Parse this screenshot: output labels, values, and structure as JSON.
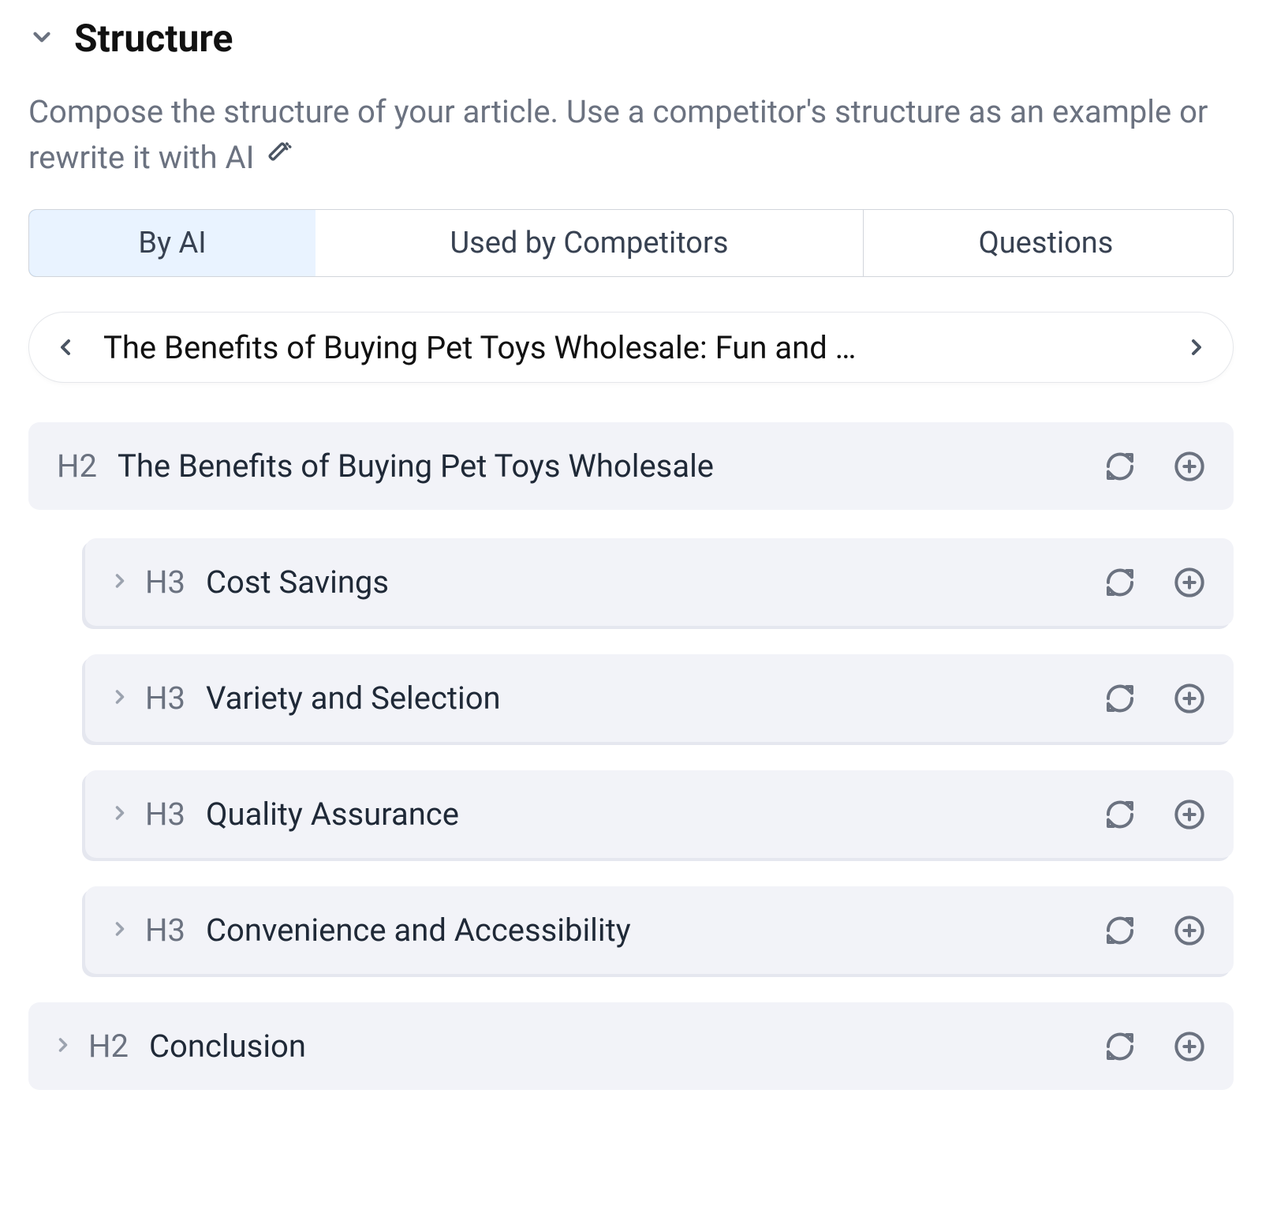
{
  "header": {
    "title": "Structure",
    "description": "Compose the structure of your article. Use a competitor's structure as an example or rewrite it with AI"
  },
  "tabs": {
    "byai": "By AI",
    "competitors": "Used by Competitors",
    "questions": "Questions"
  },
  "titleNav": {
    "text": "The Benefits of Buying Pet Toys Wholesale: Fun and …"
  },
  "outline": {
    "h2_main": {
      "level": "H2",
      "title": "The Benefits of Buying Pet Toys Wholesale"
    },
    "h3_1": {
      "level": "H3",
      "title": "Cost Savings"
    },
    "h3_2": {
      "level": "H3",
      "title": "Variety and Selection"
    },
    "h3_3": {
      "level": "H3",
      "title": "Quality Assurance"
    },
    "h3_4": {
      "level": "H3",
      "title": "Convenience and Accessibility"
    },
    "h2_end": {
      "level": "H2",
      "title": "Conclusion"
    }
  }
}
